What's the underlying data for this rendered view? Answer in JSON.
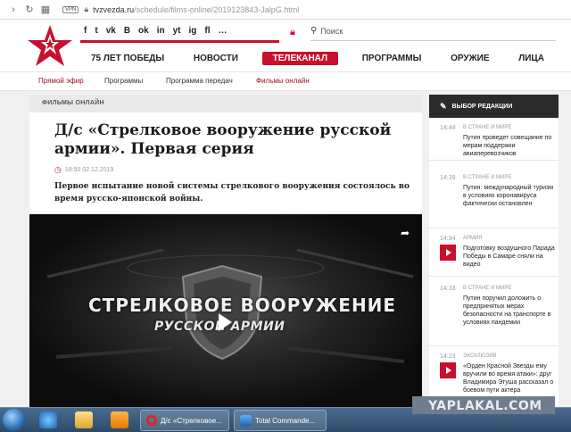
{
  "browser": {
    "vpn_label": "VPN",
    "url_host": "tvzvezda.ru",
    "url_path": "/schedule/films-online/2019123843-JalpG.html"
  },
  "header": {
    "socials": [
      "f",
      "t",
      "vk",
      "B",
      "ok",
      "in",
      "yt",
      "ig",
      "fl",
      "…"
    ],
    "search_placeholder": "Поиск",
    "nav": [
      "75 ЛЕТ ПОБЕДЫ",
      "НОВОСТИ",
      "ТЕЛЕКАНАЛ",
      "ПРОГРАММЫ",
      "ОРУЖИЕ",
      "ЛИЦА"
    ],
    "nav_active_index": 2
  },
  "subnav": [
    "Прямой эфир",
    "Программы",
    "Программа передач",
    "Фильмы онлайн"
  ],
  "article": {
    "section": "ФИЛЬМЫ ОНЛАЙН",
    "title": "Д/с «Стрелковое вооружение русской армии». Первая серия",
    "datetime": "18:50 02.12.2019",
    "lead": "Первое испытание новой системы стрелкового вооружения состоялось во время русско-японской войны.",
    "video_title_line1": "СТРЕЛКОВОЕ ВООРУЖЕНИЕ",
    "video_title_line2": "РУССКОЙ АРМИИ"
  },
  "sidebar": {
    "title": "ВЫБОР РЕДАКЦИИ",
    "news": [
      {
        "time": "14:44",
        "category": "В СТРАНЕ И МИРЕ",
        "text": "Путин проведет совещание по мерам поддержки авиаперевозчиков",
        "video": false
      },
      {
        "time": "14:39",
        "category": "В СТРАНЕ И МИРЕ",
        "text": "Путин: международный туризм в условиях коронавируса фактически остановлен",
        "video": false
      },
      {
        "time": "14:34",
        "category": "АРМИЯ",
        "text": "Подготовку воздушного Парада Победы в Самаре сняли на видео",
        "video": true
      },
      {
        "time": "14:33",
        "category": "В СТРАНЕ И МИРЕ",
        "text": "Путин поручил доложить о предпринятых мерах безопасности на транспорте в условиях пандемии",
        "video": false
      },
      {
        "time": "14:23",
        "category": "ЭКСКЛЮЗИВ",
        "text": "«Орден Красной Звезды ему вручили во время атаки»: друг Владимира Этуша рассказал о боевом пути актера",
        "video": true
      }
    ]
  },
  "taskbar": {
    "tasks": [
      "Д/с «Стрелковое...",
      "Total Commande..."
    ]
  },
  "watermark": "YAPLAKAL.COM",
  "colors": {
    "accent": "#c8102e",
    "dark": "#2b2b2b"
  }
}
